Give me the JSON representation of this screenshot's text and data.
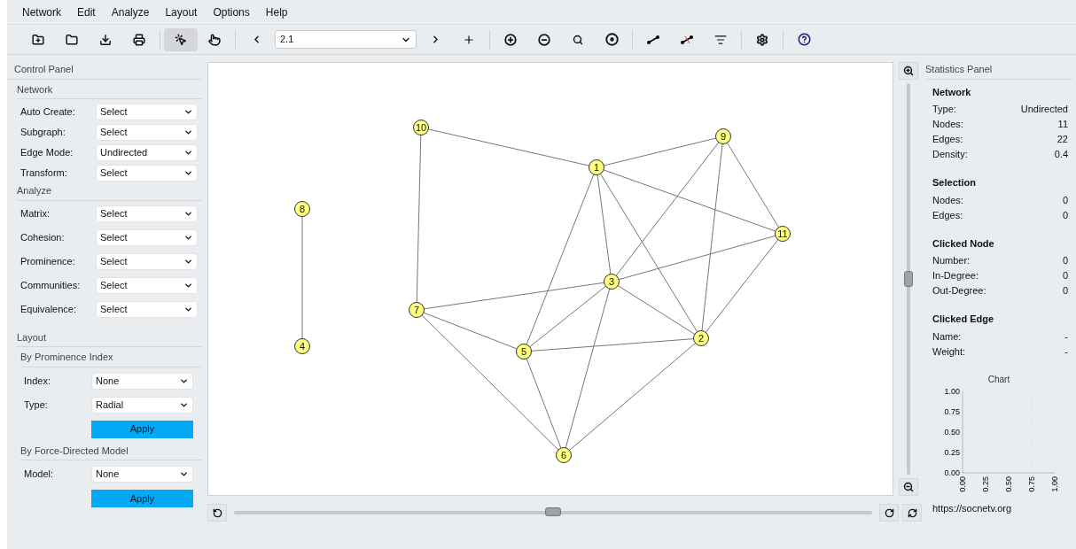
{
  "menu": [
    "Network",
    "Edit",
    "Analyze",
    "Layout",
    "Options",
    "Help"
  ],
  "toolbar": {
    "tools": [
      {
        "kind": "new",
        "selected": false
      },
      {
        "kind": "open",
        "selected": false
      },
      {
        "kind": "save",
        "selected": false
      },
      {
        "kind": "print",
        "selected": false
      },
      {
        "kind": "select",
        "selected": true
      },
      {
        "kind": "pan",
        "selected": false
      }
    ],
    "relation": "2.1"
  },
  "control_panel": {
    "title": "Control Panel",
    "sections": [
      {
        "title": "Network",
        "fields": [
          {
            "label": "Auto Create:",
            "value": "Select"
          },
          {
            "label": "Subgraph:",
            "value": "Select"
          },
          {
            "label": "Edge Mode:",
            "value": "Undirected"
          },
          {
            "label": "Transform:",
            "value": "Select"
          }
        ]
      },
      {
        "title": "Analyze",
        "fields": [
          {
            "label": "Matrix:",
            "value": "Select"
          },
          {
            "label": "Cohesion:",
            "value": "Select"
          },
          {
            "label": "Prominence:",
            "value": "Select"
          },
          {
            "label": "Communities:",
            "value": "Select"
          },
          {
            "label": "Equivalence:",
            "value": "Select"
          }
        ]
      }
    ],
    "layout": {
      "title": "Layout",
      "groups": [
        {
          "title": "By Prominence Index",
          "fields": [
            {
              "label": "Index:",
              "value": "None"
            },
            {
              "label": "Type:",
              "value": "Radial"
            }
          ],
          "button": "Apply"
        },
        {
          "title": "By Force-Directed Model",
          "fields": [
            {
              "label": "Model:",
              "value": "None"
            }
          ],
          "button": "Apply"
        }
      ]
    }
  },
  "canvas": {
    "nodes": [
      "10",
      "1",
      "9",
      "11",
      "8",
      "3",
      "7",
      "2",
      "5",
      "4",
      "6"
    ]
  },
  "zoom_slider": {
    "level": 0.5
  },
  "rotate_slider": {
    "level": 0.5
  },
  "statistics_panel": {
    "title": "Statistics Panel",
    "sections": [
      {
        "title": "Network",
        "rows": [
          {
            "label": "Type:",
            "value": "Undirected"
          },
          {
            "label": "Nodes:",
            "value": "11"
          },
          {
            "label": "Edges:",
            "value": "22"
          },
          {
            "label": "Density:",
            "value": "0.4"
          }
        ]
      },
      {
        "title": "Selection",
        "rows": [
          {
            "label": "Nodes:",
            "value": "0"
          },
          {
            "label": "Edges:",
            "value": "0"
          }
        ]
      },
      {
        "title": "Clicked Node",
        "rows": [
          {
            "label": "Number:",
            "value": "0"
          },
          {
            "label": "In-Degree:",
            "value": "0"
          },
          {
            "label": "Out-Degree:",
            "value": "0"
          }
        ]
      },
      {
        "title": "Clicked Edge",
        "rows": [
          {
            "label": "Name:",
            "value": "-"
          },
          {
            "label": "Weight:",
            "value": "-"
          }
        ]
      }
    ],
    "chart_data": {
      "type": "line",
      "title": "Chart",
      "grid": true,
      "xlim": [
        0,
        1
      ],
      "ylim": [
        0,
        1
      ],
      "xticks": [
        {
          "value": 0,
          "label": "0.00"
        },
        {
          "value": 0.25,
          "label": "0.25"
        },
        {
          "value": 0.5,
          "label": "0.50"
        },
        {
          "value": 0.75,
          "label": "0.75"
        },
        {
          "value": 1,
          "label": "1.00"
        }
      ],
      "yticks": [
        {
          "value": 0,
          "label": "0.00"
        },
        {
          "value": 0.25,
          "label": "0.25"
        },
        {
          "value": 0.5,
          "label": "0.50"
        },
        {
          "value": 0.75,
          "label": "0.75"
        },
        {
          "value": 1,
          "label": "1.00"
        }
      ]
    },
    "link": "https://socnetv.org"
  }
}
